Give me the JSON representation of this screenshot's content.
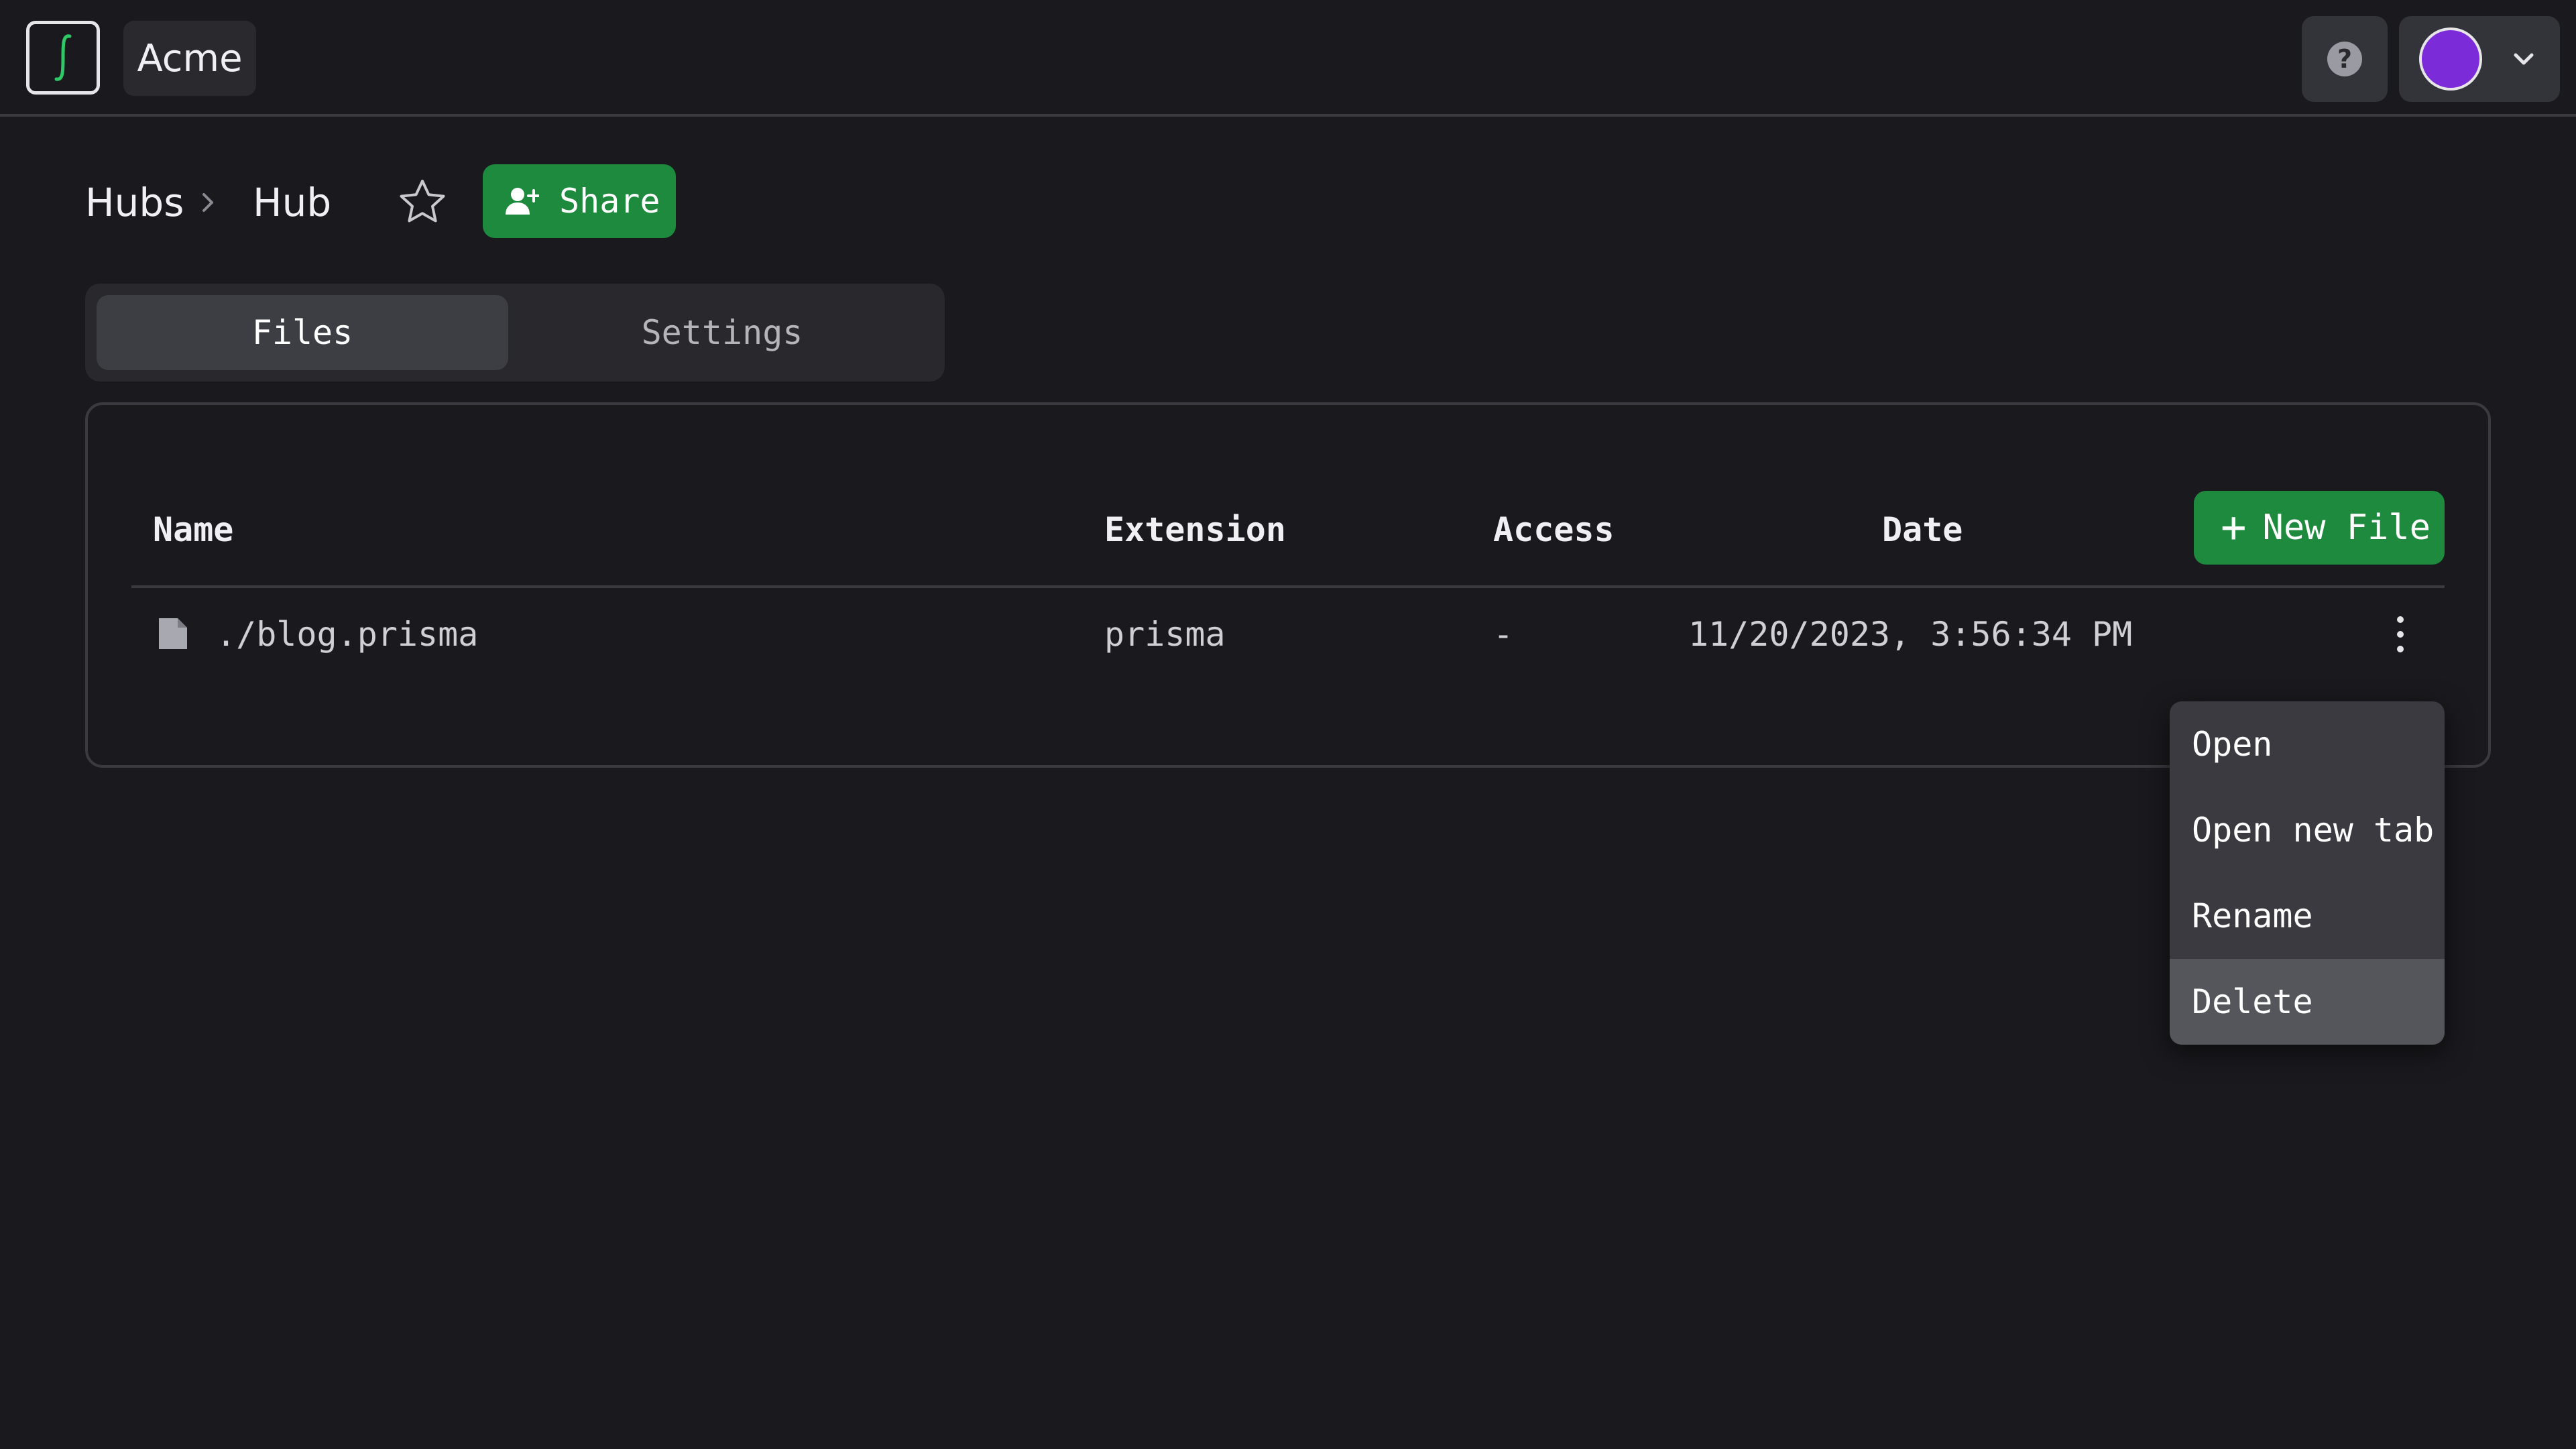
{
  "header": {
    "org_name": "Acme",
    "help_icon_glyph": "?",
    "icons": [
      "integral-logo-icon",
      "help-icon",
      "avatar",
      "chevron-down-icon"
    ],
    "avatar_color": "#7c2bd9"
  },
  "breadcrumb": {
    "items": [
      "Hubs",
      "Hub"
    ],
    "separator_icon": "chevron-right-icon"
  },
  "actions": {
    "favorite_icon": "star-outline-icon",
    "share_label": "Share",
    "share_icon": "user-plus-icon",
    "accent_color": "#1e8a3e"
  },
  "tabs": [
    {
      "label": "Files",
      "selected": true
    },
    {
      "label": "Settings",
      "selected": false
    }
  ],
  "table": {
    "columns": [
      "Name",
      "Extension",
      "Access",
      "Date"
    ],
    "new_file_label": "New File",
    "new_file_icon_glyph": "+",
    "rows": [
      {
        "icon": "file-icon",
        "name": "./blog.prisma",
        "extension": "prisma",
        "access": "-",
        "date": "11/20/2023, 3:56:34 PM"
      }
    ]
  },
  "context_menu": {
    "items": [
      "Open",
      "Open new tab",
      "Rename",
      "Delete"
    ],
    "highlighted": "Delete"
  }
}
